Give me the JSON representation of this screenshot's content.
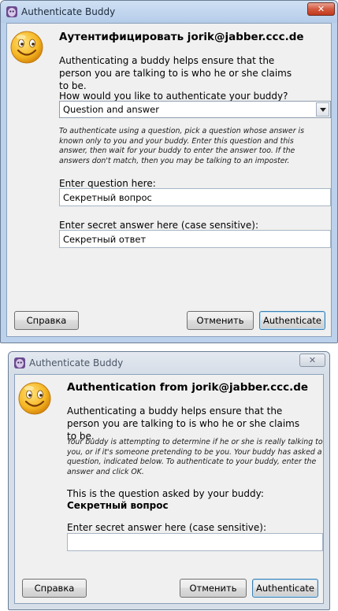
{
  "dialog1": {
    "title": "Authenticate Buddy",
    "heading": "Аутентифицировать jorik@jabber.ccc.de",
    "intro": "Authenticating a buddy helps ensure that the person you are talking to is who he or she claims to be.",
    "method_prompt": "How would you like to authenticate your buddy?",
    "method_selected": "Question and answer",
    "hint": "To authenticate using a question, pick a question whose answer is known only to you and your buddy. Enter this question and this answer, then wait for your buddy to enter the answer too. If the answers don't match, then you may be talking to an imposter.",
    "question_label": "Enter question here:",
    "question_value": "Секретный вопрос",
    "answer_label": "Enter secret answer here (case sensitive):",
    "answer_value": "Секретный ответ",
    "help_button": "Справка",
    "cancel_button": "Отменить",
    "auth_button": "Authenticate"
  },
  "dialog2": {
    "title": "Authenticate Buddy",
    "heading": "Authentication from jorik@jabber.ccc.de",
    "intro": "Authenticating a buddy helps ensure that the person you are talking to is who he or she claims to be.",
    "hint": "Your buddy is attempting to determine if he or she is really talking to you, or if it's someone pretending to be you. Your buddy has asked a question, indicated below. To authenticate to your buddy, enter the answer and click OK.",
    "question_intro": "This is the question asked by your buddy:",
    "question_value": "Секретный вопрос",
    "answer_label": "Enter secret answer here (case sensitive):",
    "answer_value": "",
    "help_button": "Справка",
    "cancel_button": "Отменить",
    "auth_button": "Authenticate"
  },
  "colors": {
    "titlebar_active": "#b5cce9",
    "close_button": "#c03a1c",
    "default_button_border": "#3c7fb1",
    "smiley": "#f5b623"
  },
  "icons": [
    "pidgin-app-icon",
    "close-icon",
    "smiley-icon",
    "dropdown-arrow-icon"
  ]
}
